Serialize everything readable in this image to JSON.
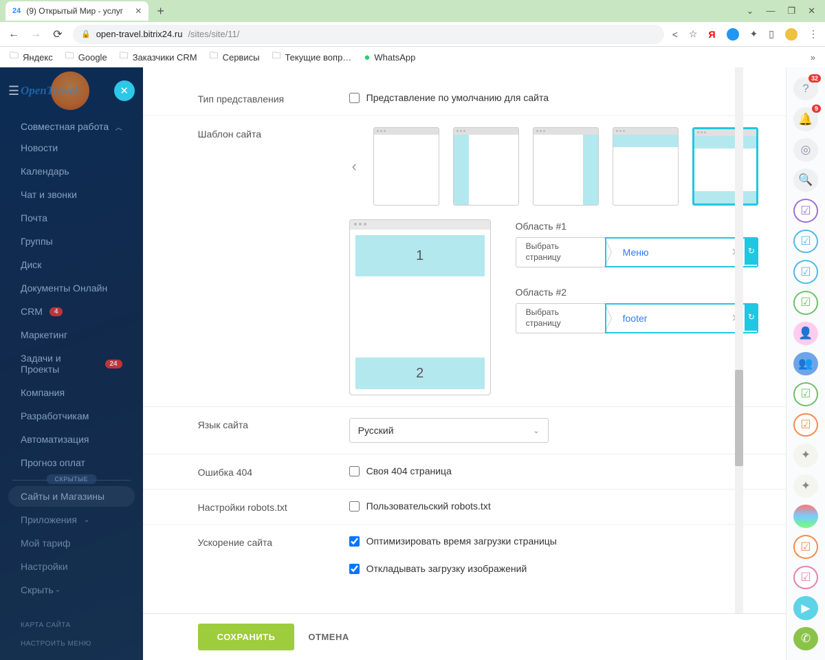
{
  "browser": {
    "tab_favicon": "24",
    "tab_title": "(9) Открытый Мир - услуг",
    "url_domain": "open-travel.bitrix24.ru",
    "url_path": "/sites/site/11/",
    "bookmarks": [
      "Яндекс",
      "Google",
      "Заказчики CRM",
      "Сервисы",
      "Текущие вопр…",
      "WhatsApp"
    ]
  },
  "sidebar": {
    "logo_text": "OpenTravel",
    "section": "Совместная работа",
    "items": [
      {
        "label": "Новости"
      },
      {
        "label": "Календарь"
      },
      {
        "label": "Чат и звонки"
      },
      {
        "label": "Почта"
      },
      {
        "label": "Группы"
      },
      {
        "label": "Диск"
      },
      {
        "label": "Документы Онлайн"
      },
      {
        "label": "CRM",
        "badge": "4"
      },
      {
        "label": "Маркетинг"
      },
      {
        "label": "Задачи и Проекты",
        "badge": "24"
      },
      {
        "label": "Компания"
      },
      {
        "label": "Разработчикам"
      },
      {
        "label": "Автоматизация"
      },
      {
        "label": "Прогноз оплат"
      }
    ],
    "hidden_label": "СКРЫТЫЕ",
    "hidden_items": [
      {
        "label": "Сайты и Магазины",
        "active": true
      },
      {
        "label": "Приложения",
        "chevron": true
      },
      {
        "label": "Мой тариф"
      },
      {
        "label": "Настройки"
      },
      {
        "label": "Скрыть -"
      }
    ],
    "footer": [
      "КАРТА САЙТА",
      "НАСТРОИТЬ МЕНЮ"
    ]
  },
  "form": {
    "view_type_label": "Тип представления",
    "view_type_checkbox": "Представление по умолчанию для сайта",
    "template_label": "Шаблон сайта",
    "area1_label": "Область #1",
    "area2_label": "Область #2",
    "select_page": "Выбрать страницу",
    "area1_value": "Меню",
    "area2_value": "footer",
    "zone1": "1",
    "zone2": "2",
    "lang_label": "Язык сайта",
    "lang_value": "Русский",
    "err404_label": "Ошибка 404",
    "err404_checkbox": "Своя 404 страница",
    "robots_label": "Настройки robots.txt",
    "robots_checkbox": "Пользовательский robots.txt",
    "speed_label": "Ускорение сайта",
    "speed_opt1": "Оптимизировать время загрузки страницы",
    "speed_opt2": "Откладывать загрузку изображений",
    "save": "СОХРАНИТЬ",
    "cancel": "ОТМЕНА"
  },
  "dock": {
    "badge1": "32",
    "badge2": "9"
  }
}
